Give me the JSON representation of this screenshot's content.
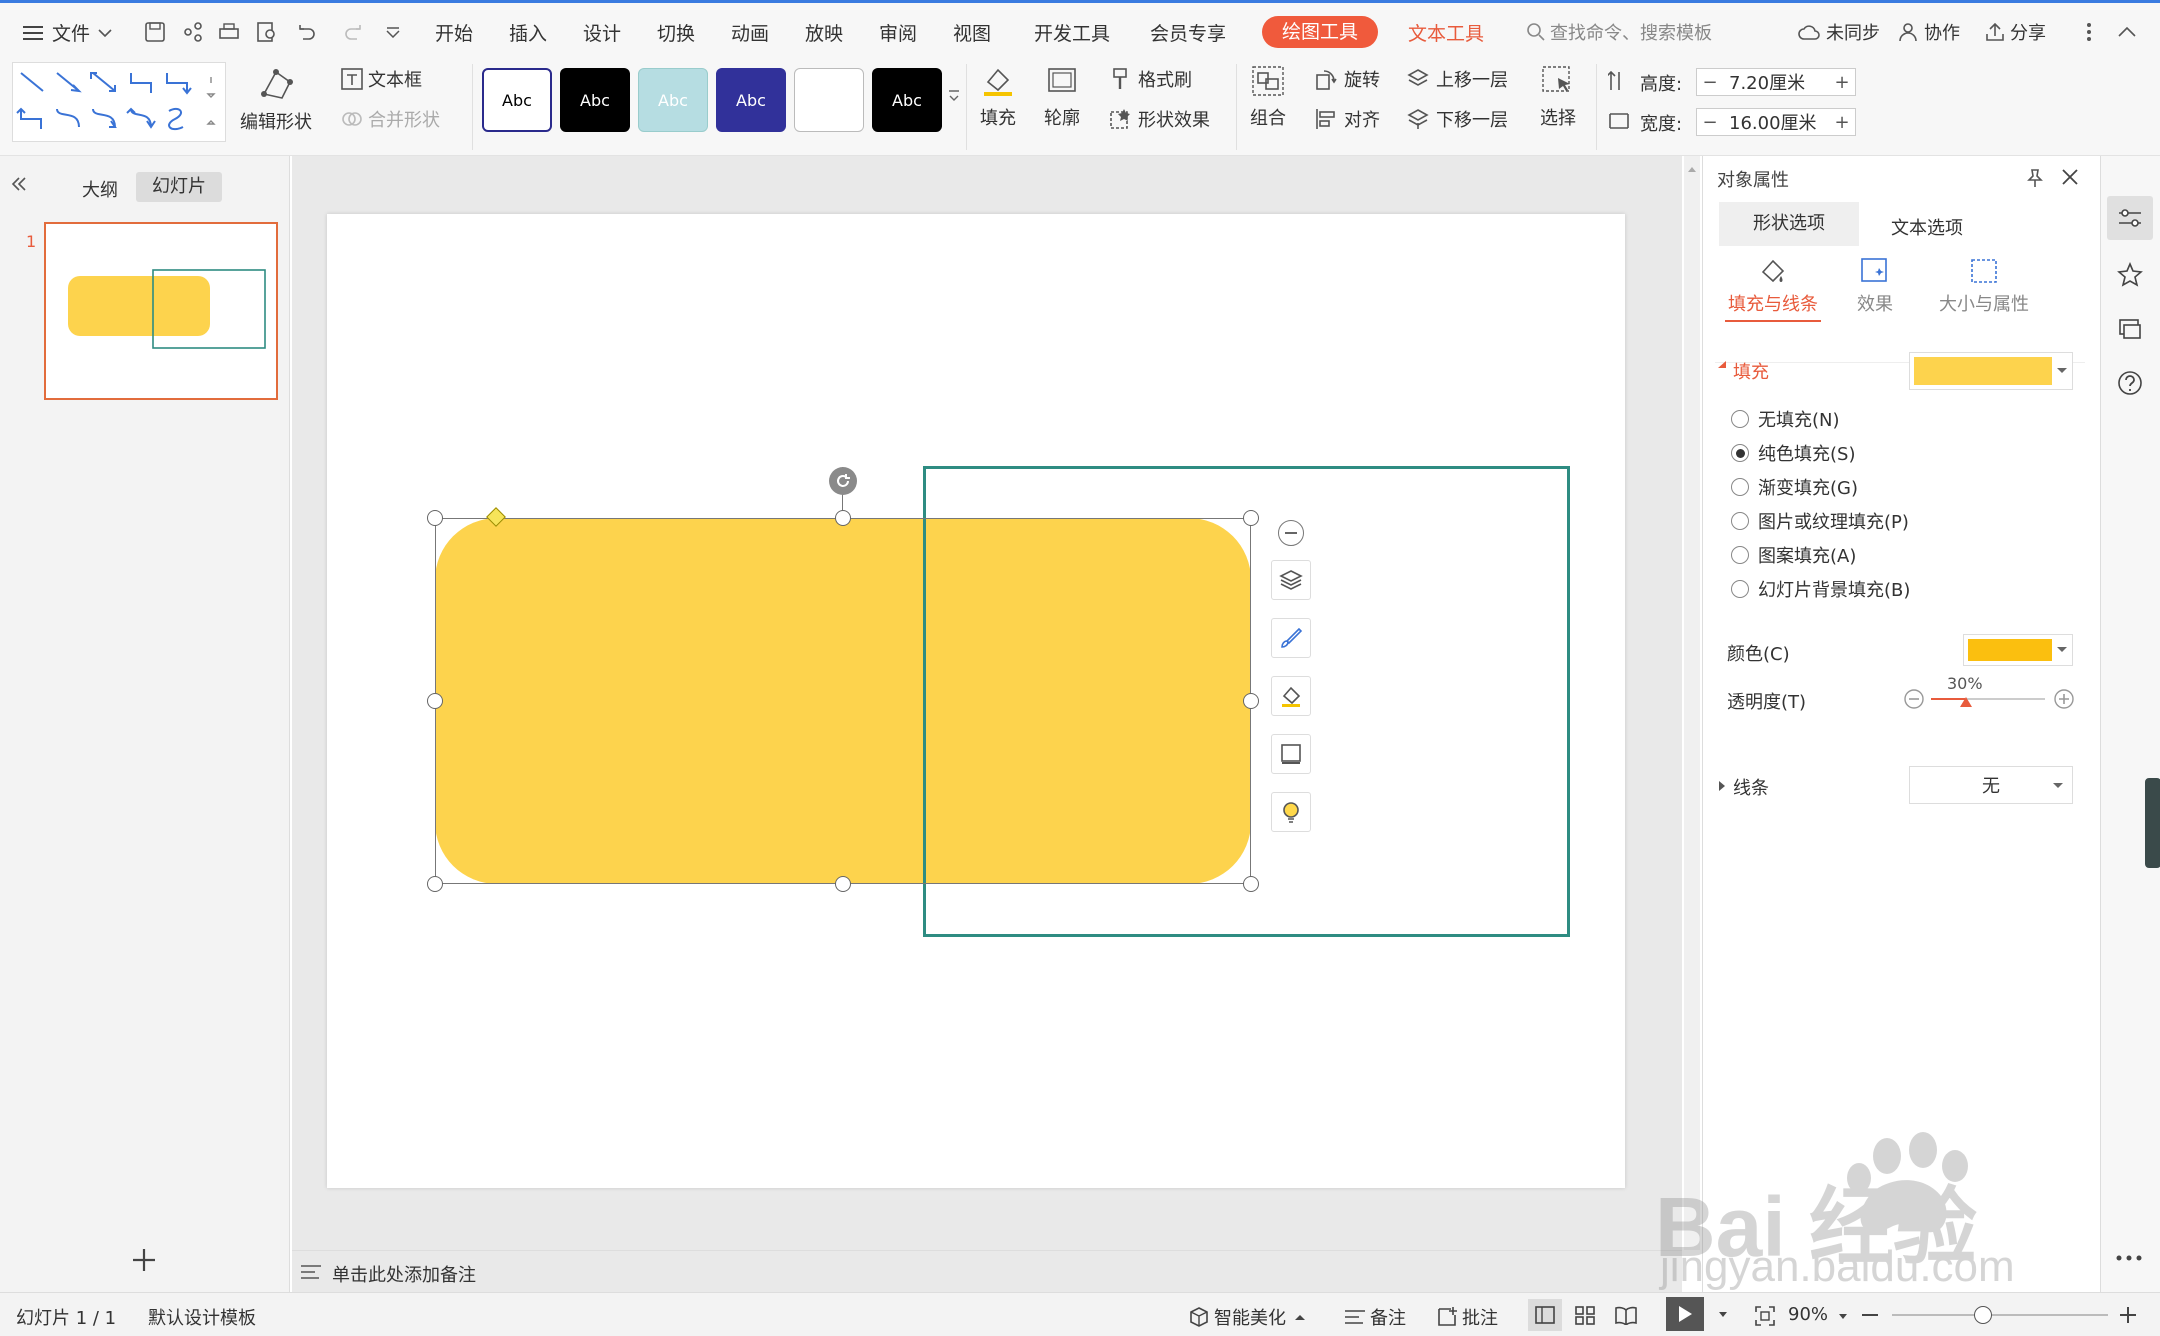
{
  "menubar": {
    "file_label": "文件",
    "tabs": [
      "开始",
      "插入",
      "设计",
      "切换",
      "动画",
      "放映",
      "审阅",
      "视图",
      "开发工具",
      "会员专享"
    ],
    "drawing_tools": "绘图工具",
    "text_tools": "文本工具",
    "search_placeholder": "查找命令、搜索模板",
    "sync": "未同步",
    "collab": "协作",
    "share": "分享"
  },
  "ribbon": {
    "edit_shape": "编辑形状",
    "textbox": "文本框",
    "merge_shape": "合并形状",
    "style_sample": "Abc",
    "fill": "填充",
    "outline": "轮廓",
    "format_painter": "格式刷",
    "shape_effect": "形状效果",
    "group": "组合",
    "rotate": "旋转",
    "align": "对齐",
    "bring_forward": "上移一层",
    "send_backward": "下移一层",
    "select": "选择",
    "height_label": "高度:",
    "height_value": "7.20厘米",
    "width_label": "宽度:",
    "width_value": "16.00厘米"
  },
  "leftpanel": {
    "outline_tab": "大纲",
    "slides_tab": "幻灯片",
    "slide_number": "1"
  },
  "notes": {
    "placeholder": "单击此处添加备注"
  },
  "rightpanel": {
    "title": "对象属性",
    "tab_shape": "形状选项",
    "tab_text": "文本选项",
    "sub_fill_line": "填充与线条",
    "sub_effect": "效果",
    "sub_size": "大小与属性",
    "fill_header": "填充",
    "fill_color": "#fdd34d",
    "options": [
      "无填充(N)",
      "纯色填充(S)",
      "渐变填充(G)",
      "图片或纹理填充(P)",
      "图案填充(A)",
      "幻灯片背景填充(B)"
    ],
    "color_label": "颜色(C)",
    "color_value": "#fbbf0f",
    "transparency_label": "透明度(T)",
    "transparency_value": "30%",
    "line_header": "线条",
    "line_value": "无"
  },
  "statusbar": {
    "slide_info": "幻灯片 1 / 1",
    "template": "默认设计模板",
    "beautify": "智能美化",
    "notes": "备注",
    "comment": "批注",
    "zoom": "90%"
  },
  "watermark": {
    "line1": "Bai 经验",
    "line2": "jingyan.baidu.com"
  },
  "colors": {
    "accent": "#e85b3c",
    "shape_fill": "#fdd34d",
    "frame_stroke": "#2e8c82"
  }
}
